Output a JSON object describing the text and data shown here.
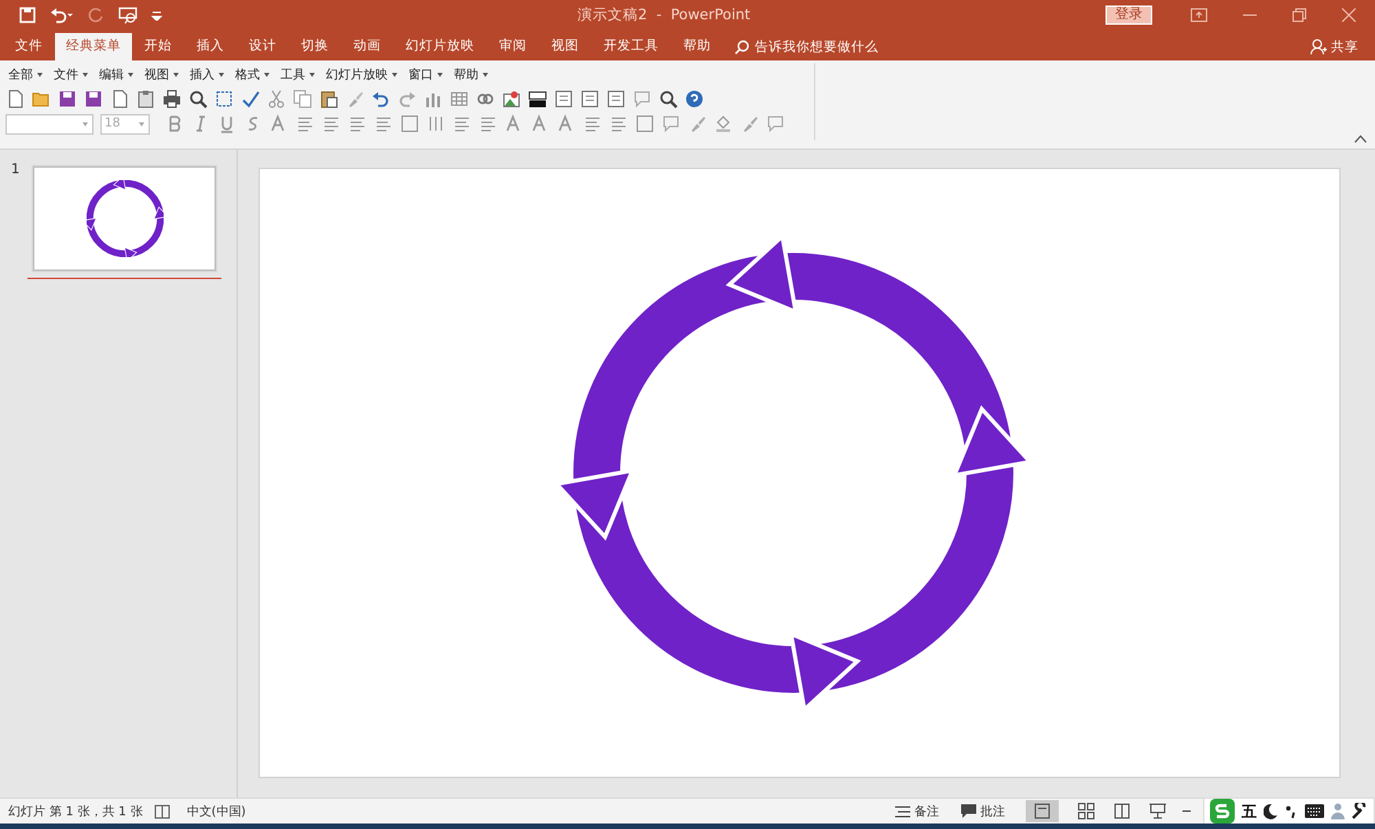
{
  "window": {
    "title": "演示文稿2  -  PowerPoint",
    "login_button": "登录"
  },
  "tabs": [
    {
      "label": "文件",
      "selected": false
    },
    {
      "label": "经典菜单",
      "selected": true
    },
    {
      "label": "开始",
      "selected": false
    },
    {
      "label": "插入",
      "selected": false
    },
    {
      "label": "设计",
      "selected": false
    },
    {
      "label": "切换",
      "selected": false
    },
    {
      "label": "动画",
      "selected": false
    },
    {
      "label": "幻灯片放映",
      "selected": false
    },
    {
      "label": "审阅",
      "selected": false
    },
    {
      "label": "视图",
      "selected": false
    },
    {
      "label": "开发工具",
      "selected": false
    },
    {
      "label": "帮助",
      "selected": false
    }
  ],
  "tell_me": {
    "placeholder": "告诉我你想要做什么"
  },
  "share_button": "共享",
  "menu": [
    "全部",
    "文件",
    "编辑",
    "视图",
    "插入",
    "格式",
    "工具",
    "幻灯片放映",
    "窗口",
    "帮助"
  ],
  "font_size_field": {
    "value": "18",
    "disabled": true
  },
  "thumbnails": [
    {
      "number": "1",
      "selected": true
    }
  ],
  "status_bar": {
    "slide_info": "幻灯片 第 1 张，共 1 张",
    "language": "中文(中国)",
    "notes_button": "备注",
    "comments_button": "批注",
    "ime_mode": "五"
  }
}
